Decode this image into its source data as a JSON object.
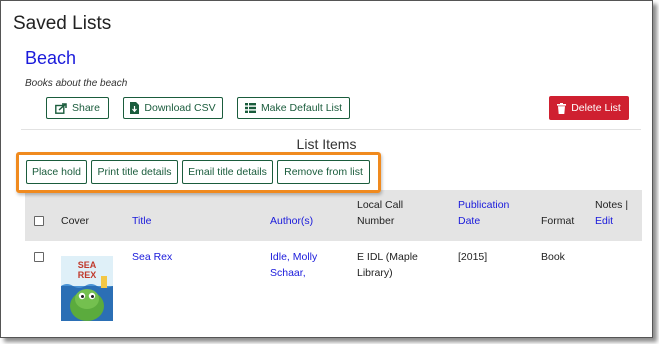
{
  "page": {
    "title": "Saved Lists"
  },
  "list": {
    "name": "Beach",
    "description": "Books about the beach"
  },
  "toolbar": {
    "share_label": "Share",
    "download_csv_label": "Download CSV",
    "make_default_label": "Make Default List",
    "delete_label": "Delete List"
  },
  "items_section": {
    "heading": "List Items"
  },
  "bulk_actions": {
    "place_hold": "Place hold",
    "print_details": "Print title details",
    "email_details": "Email title details",
    "remove": "Remove from list"
  },
  "table": {
    "headers": {
      "cover": "Cover",
      "title": "Title",
      "authors": "Author(s)",
      "call_number_line1": "Local Call",
      "call_number_line2": "Number",
      "pub_date_line1": "Publication",
      "pub_date_line2": "Date",
      "format": "Format",
      "notes": "Notes |",
      "edit": "Edit"
    },
    "rows": [
      {
        "cover_text_line1": "SEA",
        "cover_text_line2": "REX",
        "title": "Sea Rex",
        "author_line1": "Idle, Molly",
        "author_line2": "Schaar,",
        "call_number_line1": "E IDL (Maple",
        "call_number_line2": "Library)",
        "pub_date": "[2015]",
        "format": "Book"
      }
    ]
  },
  "colors": {
    "link": "#1a1adb",
    "button_border": "#1a5c3c",
    "danger": "#cf2030",
    "highlight": "#f08a1e",
    "table_header_bg": "#e4e4e4"
  },
  "icons": {
    "share": "share-icon",
    "download": "download-file-icon",
    "default": "list-icon",
    "delete": "trash-icon"
  }
}
